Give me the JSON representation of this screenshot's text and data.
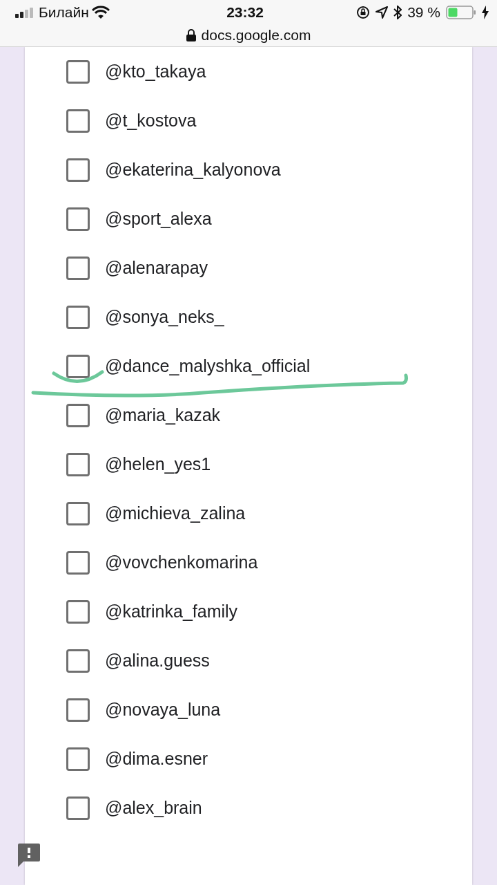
{
  "status_bar": {
    "carrier": "Билайн",
    "time": "23:32",
    "battery_percent": "39 %",
    "url": "docs.google.com"
  },
  "options": [
    {
      "label": "@kto_takaya",
      "checked": false,
      "annotated": false
    },
    {
      "label": "@t_kostova",
      "checked": false,
      "annotated": false
    },
    {
      "label": "@ekaterina_kalyonova",
      "checked": false,
      "annotated": false
    },
    {
      "label": "@sport_alexa",
      "checked": false,
      "annotated": false
    },
    {
      "label": "@alenarapay",
      "checked": false,
      "annotated": false
    },
    {
      "label": "@sonya_neks_",
      "checked": false,
      "annotated": false
    },
    {
      "label": "@dance_malyshka_official",
      "checked": false,
      "annotated": true
    },
    {
      "label": "@maria_kazak",
      "checked": false,
      "annotated": false
    },
    {
      "label": "@helen_yes1",
      "checked": false,
      "annotated": false
    },
    {
      "label": "@michieva_zalina",
      "checked": false,
      "annotated": false
    },
    {
      "label": "@vovchenkomarina",
      "checked": false,
      "annotated": false
    },
    {
      "label": "@katrinka_family",
      "checked": false,
      "annotated": false
    },
    {
      "label": "@alina.guess",
      "checked": false,
      "annotated": false
    },
    {
      "label": "@novaya_luna",
      "checked": false,
      "annotated": false
    },
    {
      "label": "@dima.esner",
      "checked": false,
      "annotated": false
    },
    {
      "label": "@alex_brain",
      "checked": false,
      "annotated": false
    }
  ]
}
